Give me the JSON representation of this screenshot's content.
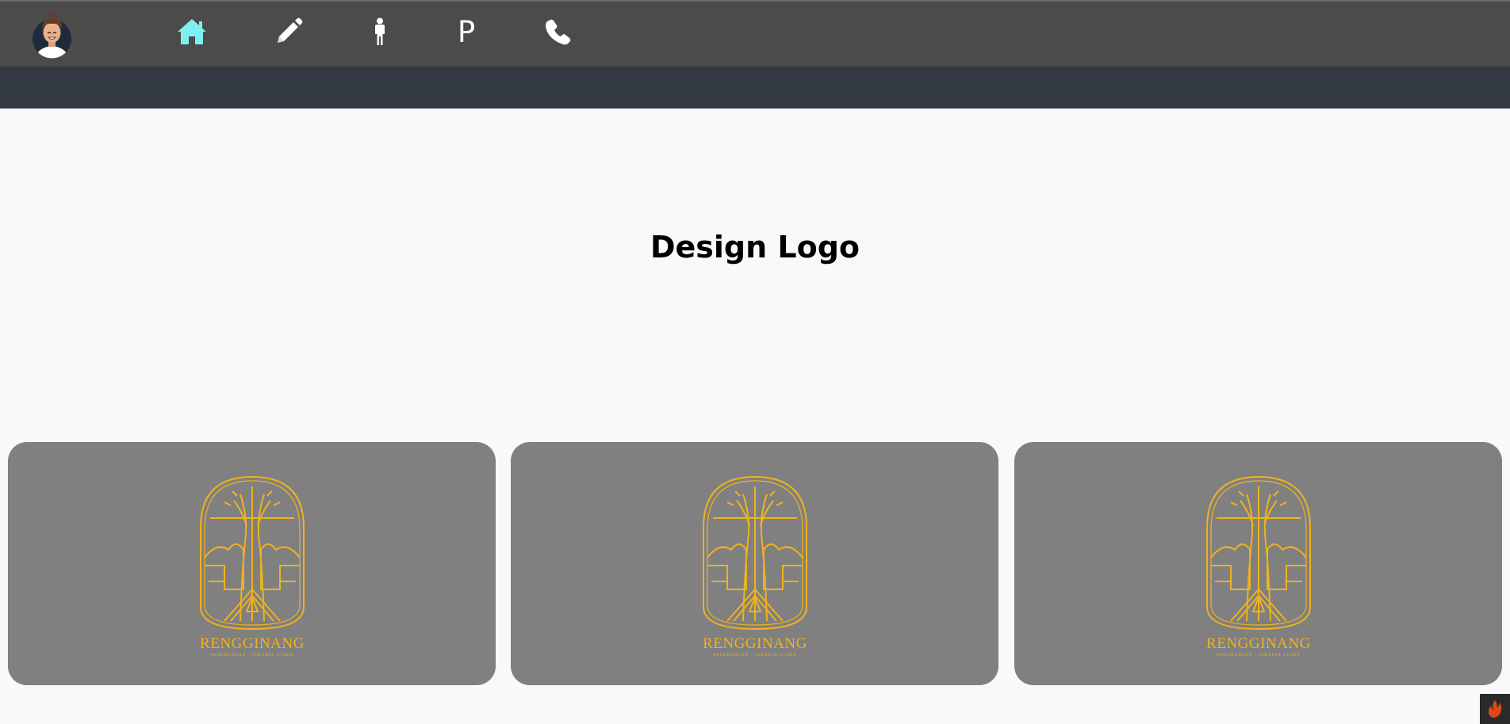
{
  "nav": {
    "items": [
      {
        "name": "home-icon",
        "label": ""
      },
      {
        "name": "pencil-icon",
        "label": ""
      },
      {
        "name": "person-icon",
        "label": ""
      },
      {
        "name": "portfolio-letter",
        "label": "P"
      },
      {
        "name": "phone-icon",
        "label": ""
      }
    ],
    "active_color": "#7ff0f0",
    "icon_color": "#ffffff"
  },
  "main": {
    "title": "Design Logo"
  },
  "cards": [
    {
      "logo_name": "RENGGINANG",
      "logo_tagline": "PADEMANGAN · JAKARTA UTARA"
    },
    {
      "logo_name": "RENGGINANG",
      "logo_tagline": "PADEMANGAN · JAKARTA UTARA"
    },
    {
      "logo_name": "RENGGINANG",
      "logo_tagline": "PADEMANGAN · JAKARTA UTARA"
    }
  ],
  "colors": {
    "nav_bg": "#4b4b4b",
    "subbar_bg": "#343a42",
    "card_bg": "#808080",
    "logo_gold": "#f0b21c",
    "page_bg": "#f8f9fb"
  }
}
